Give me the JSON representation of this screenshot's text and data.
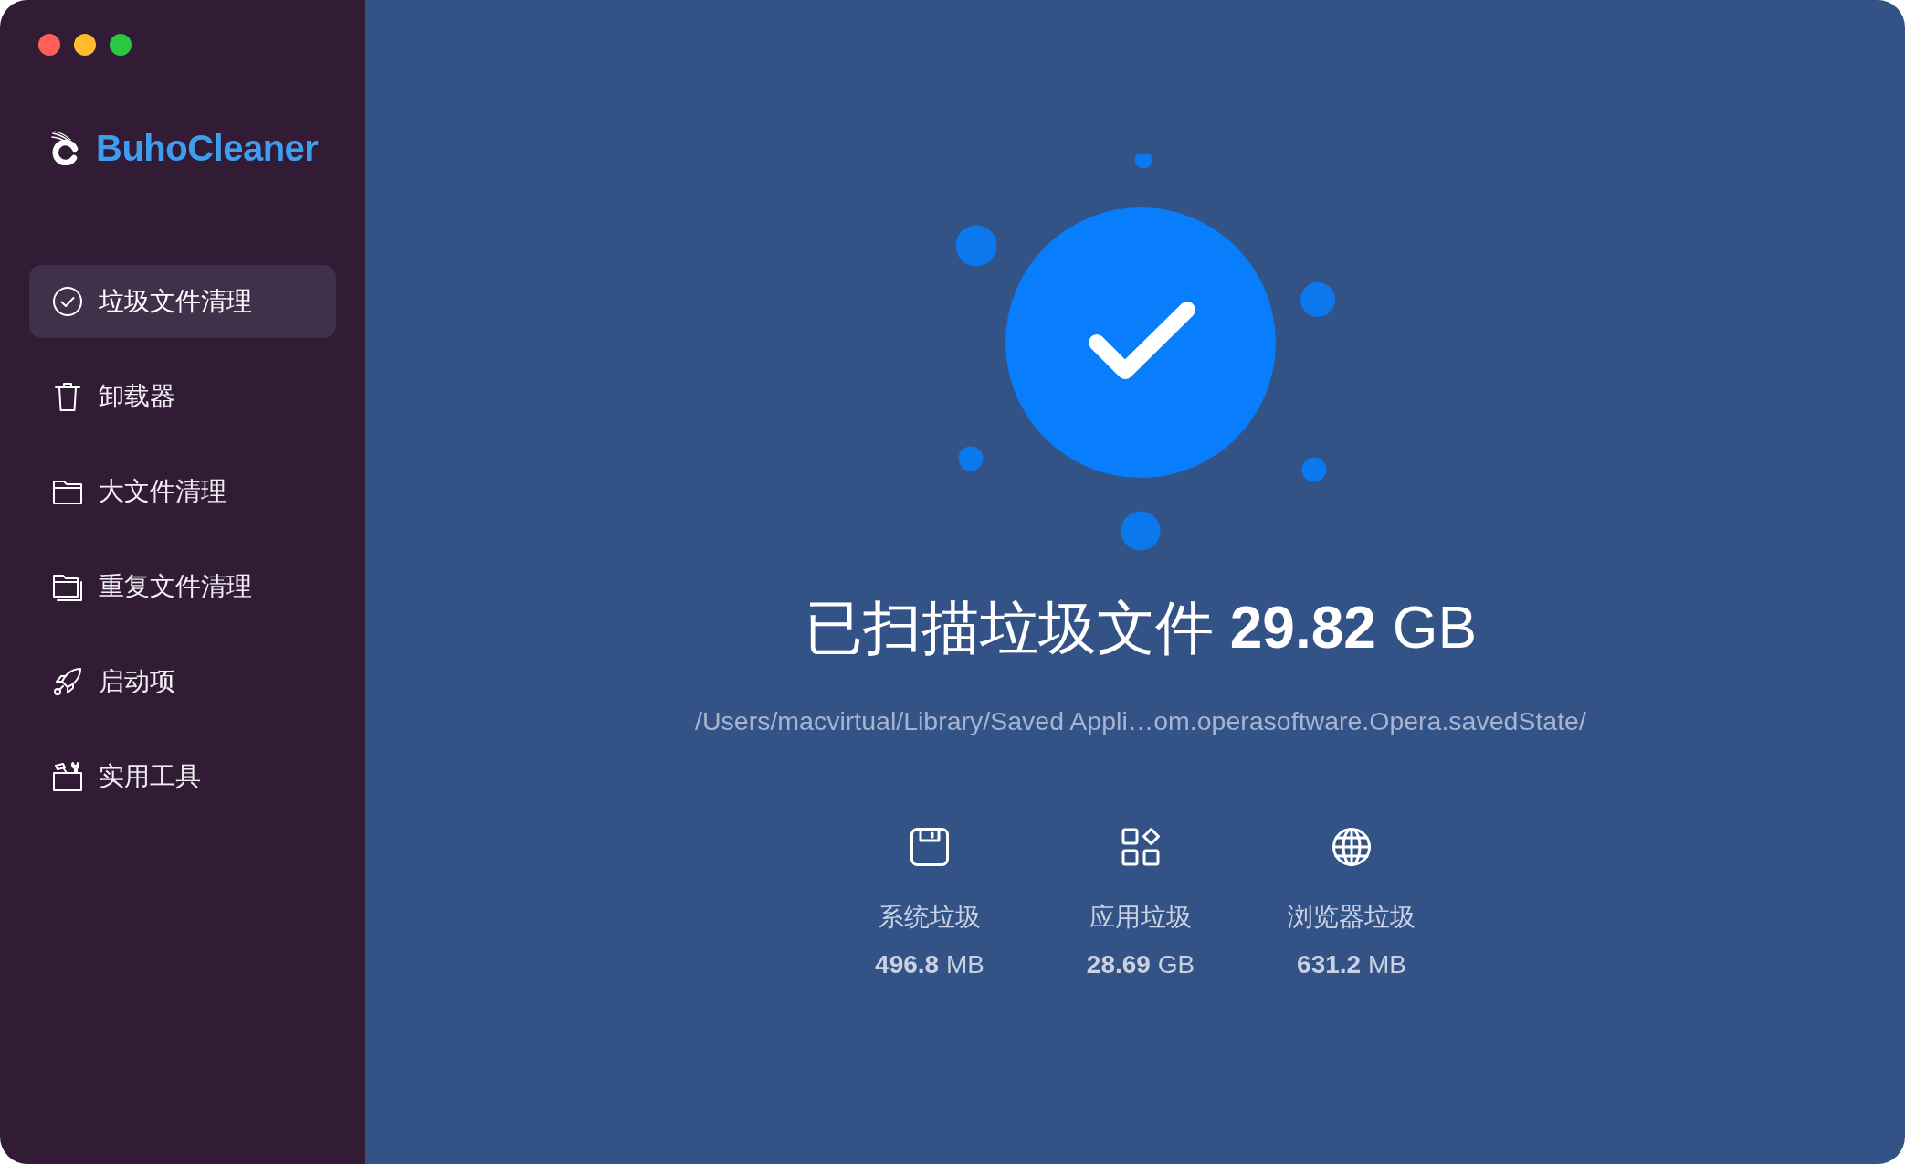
{
  "window": {
    "traffic_lights": [
      {
        "color": "#fe5f57"
      },
      {
        "color": "#febc2e"
      },
      {
        "color": "#28c840"
      }
    ]
  },
  "sidebar": {
    "app_name": "BuhoCleaner",
    "items": [
      {
        "label": "垃圾文件清理",
        "selected": true
      },
      {
        "label": "卸载器",
        "selected": false
      },
      {
        "label": "大文件清理",
        "selected": false
      },
      {
        "label": "重复文件清理",
        "selected": false
      },
      {
        "label": "启动项",
        "selected": false
      },
      {
        "label": "实用工具",
        "selected": false
      }
    ]
  },
  "scan_result": {
    "title": "已扫描垃圾文件 **29.82** GB",
    "path": "/Users/macvirtual/Library/Saved Appli…om.operasoftware.Opera.savedState/"
  },
  "categories": [
    {
      "label": "系统垃圾",
      "size": "**496.8** MB"
    },
    {
      "label": "应用垃圾",
      "size": "**28.69** GB"
    },
    {
      "label": "浏览器垃圾",
      "size": "**631.2** MB"
    }
  ]
}
